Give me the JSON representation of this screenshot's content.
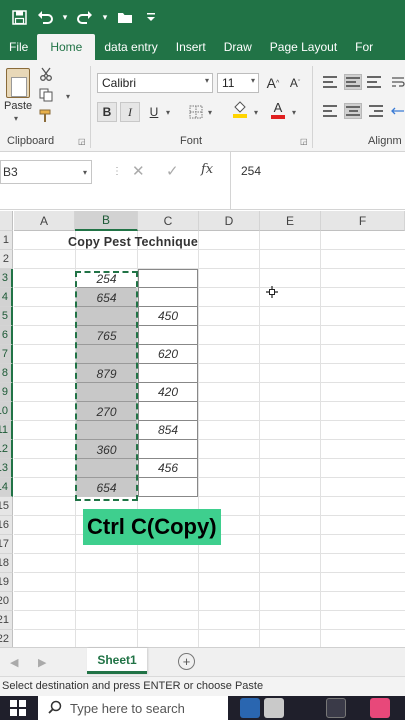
{
  "quick_access": {
    "save_icon": "save-icon",
    "undo_icon": "undo-icon",
    "redo_icon": "redo-icon",
    "open_icon": "folder-open-icon",
    "customize_icon": "customize-icon"
  },
  "tabs": [
    "File",
    "Home",
    "data entry",
    "Insert",
    "Draw",
    "Page Layout",
    "For"
  ],
  "active_tab": "Home",
  "ribbon": {
    "clipboard": {
      "paste_label": "Paste",
      "group_label": "Clipboard"
    },
    "font": {
      "font_name": "Calibri",
      "font_size": "11",
      "grow_label": "A",
      "shrink_label": "A",
      "bold": "B",
      "italic": "I",
      "underline": "U",
      "font_color_glyph": "A",
      "group_label": "Font"
    },
    "alignment": {
      "group_label": "Alignm"
    }
  },
  "formula_bar": {
    "name_box": "B3",
    "cancel_glyph": "✕",
    "enter_glyph": "✓",
    "fx": "fx",
    "formula": "254"
  },
  "grid": {
    "columns": [
      "A",
      "B",
      "C",
      "D",
      "E",
      "F"
    ],
    "selected_column": "B",
    "rows": [
      "1",
      "2",
      "3",
      "4",
      "5",
      "6",
      "7",
      "8",
      "9",
      "10",
      "11",
      "12",
      "13",
      "14",
      "15",
      "16",
      "17",
      "18",
      "19",
      "20",
      "21",
      "22"
    ],
    "title": "Copy Pest Technique",
    "column_b": [
      "254",
      "654",
      "",
      "765",
      "",
      "879",
      "",
      "270",
      "",
      "360",
      "",
      "654"
    ],
    "column_c": [
      "",
      "",
      "450",
      "",
      "620",
      "",
      "420",
      "",
      "854",
      "",
      "456",
      ""
    ],
    "caption": "Ctrl C(Copy)"
  },
  "sheets": {
    "active": "Sheet1",
    "add_glyph": "+"
  },
  "status_bar": {
    "message": "Select destination and press ENTER or choose Paste"
  },
  "taskbar": {
    "search_placeholder": "Type here to search"
  },
  "colors": {
    "excel_green": "#217346",
    "caption_bg": "#3ecf8e",
    "selection_fill": "#c8c8c8"
  }
}
